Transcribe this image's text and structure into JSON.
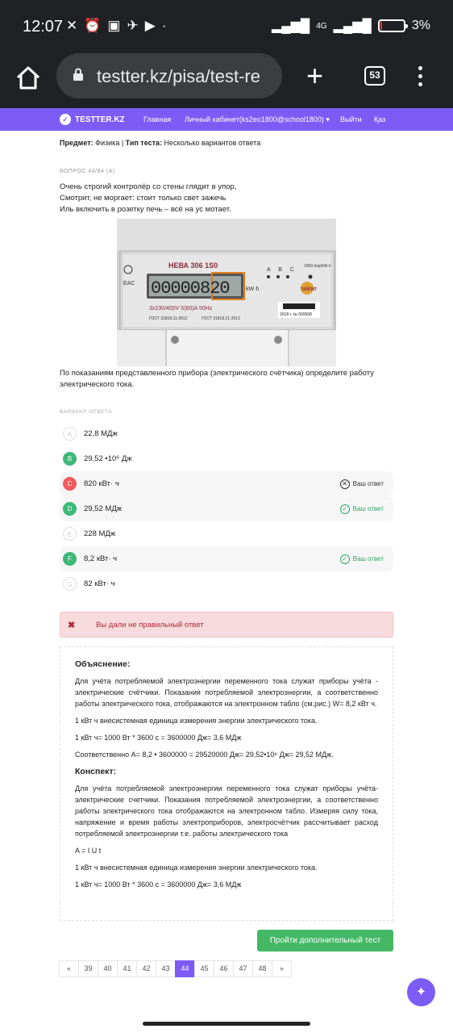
{
  "status": {
    "time": "12:07",
    "network": "4G",
    "battery": "3%"
  },
  "browser": {
    "url": "testter.kz/pisa/test-re",
    "tab_count": "53"
  },
  "nav": {
    "brand": "TESTTER.KZ",
    "items": [
      "Главная",
      "Личный кабинет(ks2eo1800@school1800) ▾",
      "Выйти",
      "Қаз"
    ]
  },
  "meta": {
    "subject_label": "Предмет:",
    "subject": "Физика",
    "sep": " | ",
    "type_label": "Тип теста:",
    "type": "Несколько вариантов ответа"
  },
  "question": {
    "number": "ВОПРОС 44/84 (A)",
    "poem": [
      "Очень строгий контролёр со стены глядит в упор,",
      "Смотрит, не моргает: стоит только свет зажечь",
      "Иль включить в розетку печь – всё на ус мотает."
    ],
    "text": "По показаниям представленного прибора (электрического счётчика) определите работу электрического тока."
  },
  "meter": {
    "model": "НЕВА 306 1S0",
    "digits": "00000820",
    "unit": "kW·h",
    "phases": "A B C",
    "rate": "1600 imp/kW·h",
    "spec": "3x230/400V 5(60)A 50Hz",
    "gost1": "ГОСТ 31818.11-2012",
    "gost2": "ГОСТ 31819.21-2012",
    "serial": "2018 г. № 009938",
    "brand_logo": "ТАЙПИТ"
  },
  "answers_label": "ВАРИАНТ ОТВЕТА",
  "answers": [
    {
      "letter": "A",
      "text": "22,8 МДж",
      "state": "none"
    },
    {
      "letter": "B",
      "text": "29,52 •10⁶ Дж",
      "state": "correct"
    },
    {
      "letter": "C",
      "text": "820 кВт· ч",
      "state": "wrong",
      "mark": "Ваш ответ"
    },
    {
      "letter": "D",
      "text": "29,52 МДж",
      "state": "correct",
      "mark": "Ваш ответ"
    },
    {
      "letter": "E",
      "text": "228 МДж",
      "state": "none"
    },
    {
      "letter": "F",
      "text": "8,2 кВт· ч",
      "state": "correct",
      "mark": "Ваш ответ"
    },
    {
      "letter": "G",
      "text": "82 кВт· ч",
      "state": "none"
    }
  ],
  "alert": {
    "icon": "✖",
    "text": "Вы дали не правильный ответ"
  },
  "explanation": {
    "title": "Объяснение:",
    "p1": "Для учёта потребляемой электроэнергии переменного тока служат приборы учёта - электрические счётчики. Показания потребляемой электроэнергии, а соответственно работы электрического тока, отображаются на электронном табло (см.рис.)  W= 8,2 кВт ч.",
    "p2": "1 кВт ч внесистемная единица измерения энергии электрического тока.",
    "p3": "1 кВт ч= 1000 Вт * 3600 с = 3600000 Дж= 3,6 МДж",
    "p4": "Соответственно    А= 8,2 • 3600000 = 29520000 Дж= 29,52•10⁶ Дж= 29,52 МДж.",
    "title2": "Конспект:",
    "q1": "Для учёта потребляемой электроэнергии переменного тока служат приборы учёта- электрические счетчики. Показания потребляемой электроэнергии, а соответственно работы электрического тока отображаются на электронном табло. Измеряя силу тока, напряжение и время работы электроприборов, электросчётчик рассчитывает расход потребляемой электроэнергии т.е. работы электрического тока",
    "q2": "A = I U t",
    "q3": "1 кВт ч внесистемная единица измерения энергии электрического тока.",
    "q4": "1 кВт ч= 1000 Вт * 3600 с = 3600000 Дж= 3,6 МДж"
  },
  "more_button": "Пройти дополнительный тест",
  "pager": [
    "«",
    "39",
    "40",
    "41",
    "42",
    "43",
    "44",
    "45",
    "46",
    "47",
    "48",
    "»"
  ],
  "pager_active": "44"
}
